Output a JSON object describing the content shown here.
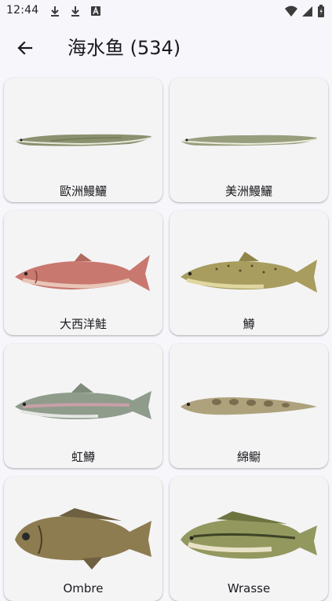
{
  "status_bar": {
    "time": "12:44",
    "left_icons": [
      "download-icon",
      "download-icon",
      "text-a-icon"
    ],
    "right_icons": [
      "wifi-icon",
      "signal-icon",
      "battery-icon"
    ]
  },
  "app_bar": {
    "back_icon": "arrow-left-icon",
    "title": "海水鱼 (534)"
  },
  "fish": [
    {
      "name": "歐洲鰻鱺",
      "icon": "eel-icon",
      "color": "#7f8a68"
    },
    {
      "name": "美洲鰻鱺",
      "icon": "eel-icon",
      "color": "#8d9574"
    },
    {
      "name": "大西洋鮭",
      "icon": "salmon-icon",
      "color": "#c9766e"
    },
    {
      "name": "鱒",
      "icon": "trout-icon",
      "color": "#a39a5a"
    },
    {
      "name": "虹鱒",
      "icon": "rainbow-trout-icon",
      "color": "#8a9a8a"
    },
    {
      "name": "綿鳚",
      "icon": "eelpout-icon",
      "color": "#a39a74"
    },
    {
      "name": "Ombre",
      "icon": "drum-fish-icon",
      "color": "#8a7a50"
    },
    {
      "name": "Wrasse",
      "icon": "wrasse-icon",
      "color": "#8a9460"
    }
  ],
  "colors": {
    "background": "#f7f6fb",
    "card": "#f4f4f5",
    "text": "#1b1b1f"
  }
}
